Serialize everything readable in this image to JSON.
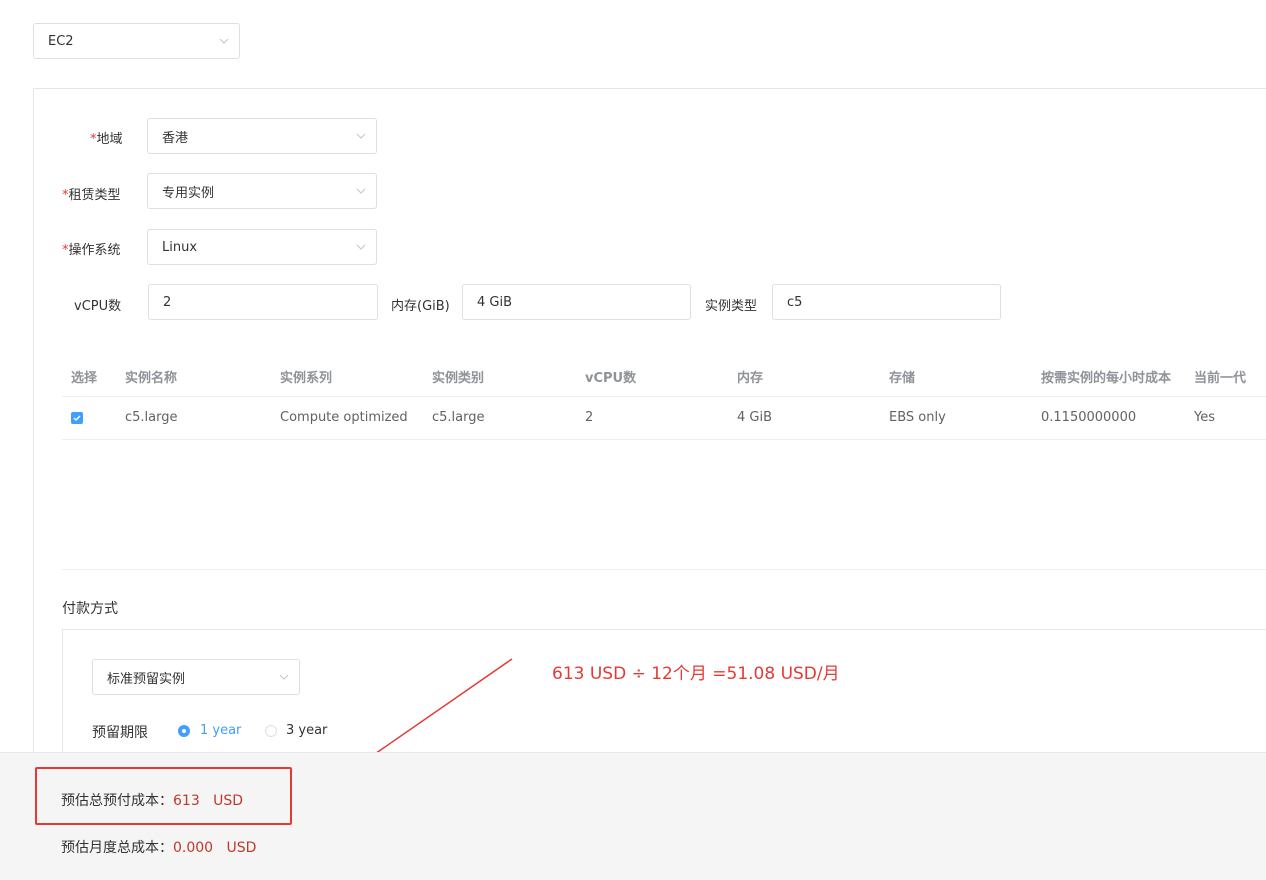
{
  "service_select": {
    "value": "EC2"
  },
  "form": {
    "region": {
      "label": "地域",
      "value": "香港"
    },
    "lease_type": {
      "label": "租赁类型",
      "value": "专用实例"
    },
    "os": {
      "label": "操作系统",
      "value": "Linux"
    },
    "vcpu": {
      "label": "vCPU数",
      "value": "2"
    },
    "memory": {
      "label": "内存(GiB)",
      "value": "4 GiB"
    },
    "instance_type": {
      "label": "实例类型",
      "value": "c5"
    }
  },
  "table": {
    "headers": [
      "选择",
      "实例名称",
      "实例系列",
      "实例类别",
      "vCPU数",
      "内存",
      "存储",
      "按需实例的每小时成本",
      "当前一代"
    ],
    "rows": [
      {
        "selected": true,
        "name": "c5.large",
        "family": "Compute optimized",
        "category": "c5.large",
        "vcpu": "2",
        "memory": "4 GiB",
        "storage": "EBS only",
        "hourly_cost": "0.1150000000",
        "current_gen": "Yes"
      }
    ]
  },
  "payment": {
    "title": "付款方式",
    "method": "标准预留实例",
    "term_label": "预留期限",
    "term_options": [
      "1 year",
      "3 year"
    ],
    "term_selected": "1 year"
  },
  "annotation": {
    "text": "613 USD ÷ 12个月 =51.08 USD/月"
  },
  "footer": {
    "upfront_label": "预估总预付成本：",
    "upfront_value": "613",
    "upfront_unit": "USD",
    "monthly_label": "预估月度总成本：",
    "monthly_value": "0.000",
    "monthly_unit": "USD"
  },
  "colors": {
    "accent": "#409eff",
    "annotation_red": "#e53935",
    "value_red": "#c0392b"
  }
}
